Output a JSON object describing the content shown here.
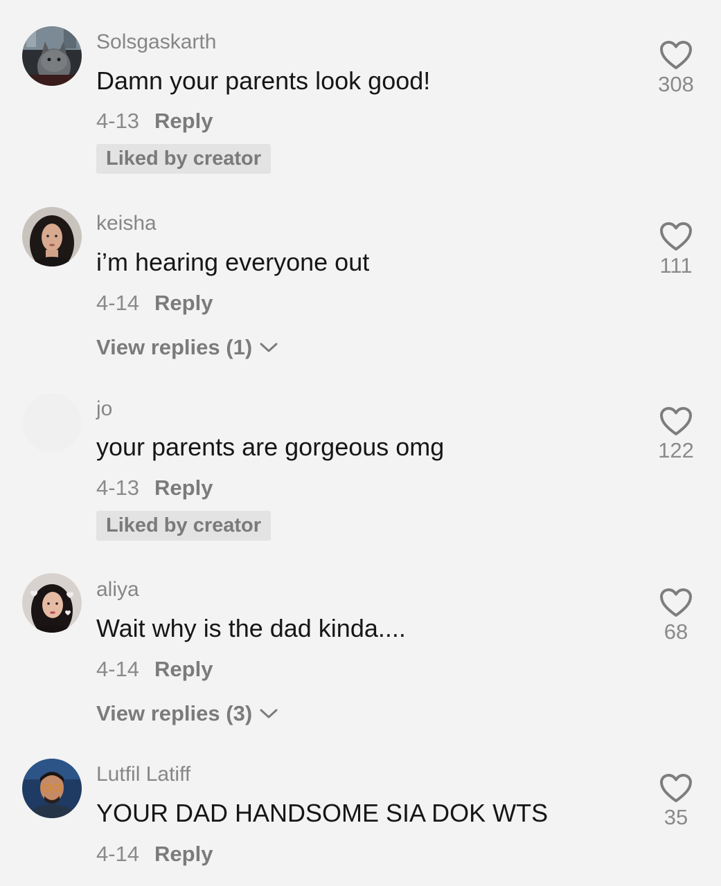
{
  "comments": [
    {
      "username": "Solsgaskarth",
      "text": "Damn your parents look good!",
      "date": "4-13",
      "reply_label": "Reply",
      "badge": "Liked by creator",
      "likes": "308",
      "avatar": "cat-photo-avatar"
    },
    {
      "username": "keisha",
      "text": "i’m hearing everyone out",
      "date": "4-14",
      "reply_label": "Reply",
      "view_replies": "View replies (1)",
      "likes": "111",
      "avatar": "woman-portrait-avatar"
    },
    {
      "username": "jo",
      "text": "your parents are gorgeous omg",
      "date": "4-13",
      "reply_label": "Reply",
      "badge": "Liked by creator",
      "likes": "122",
      "avatar": "blank-avatar"
    },
    {
      "username": "aliya",
      "text": "Wait why is the dad kinda....",
      "date": "4-14",
      "reply_label": "Reply",
      "view_replies": "View replies (3)",
      "likes": "68",
      "avatar": "woman-hearts-avatar"
    },
    {
      "username": "Lutfil Latiff",
      "text": "YOUR DAD HANDSOME SIA DOK WTS",
      "date": "4-14",
      "reply_label": "Reply",
      "likes": "35",
      "avatar": "man-glasses-avatar"
    }
  ],
  "colors": {
    "background": "#f3f3f3",
    "username": "#868686",
    "text": "#161616",
    "badge_bg": "#e3e3e3"
  },
  "icons": [
    "heart-outline-icon",
    "chevron-down-icon"
  ]
}
